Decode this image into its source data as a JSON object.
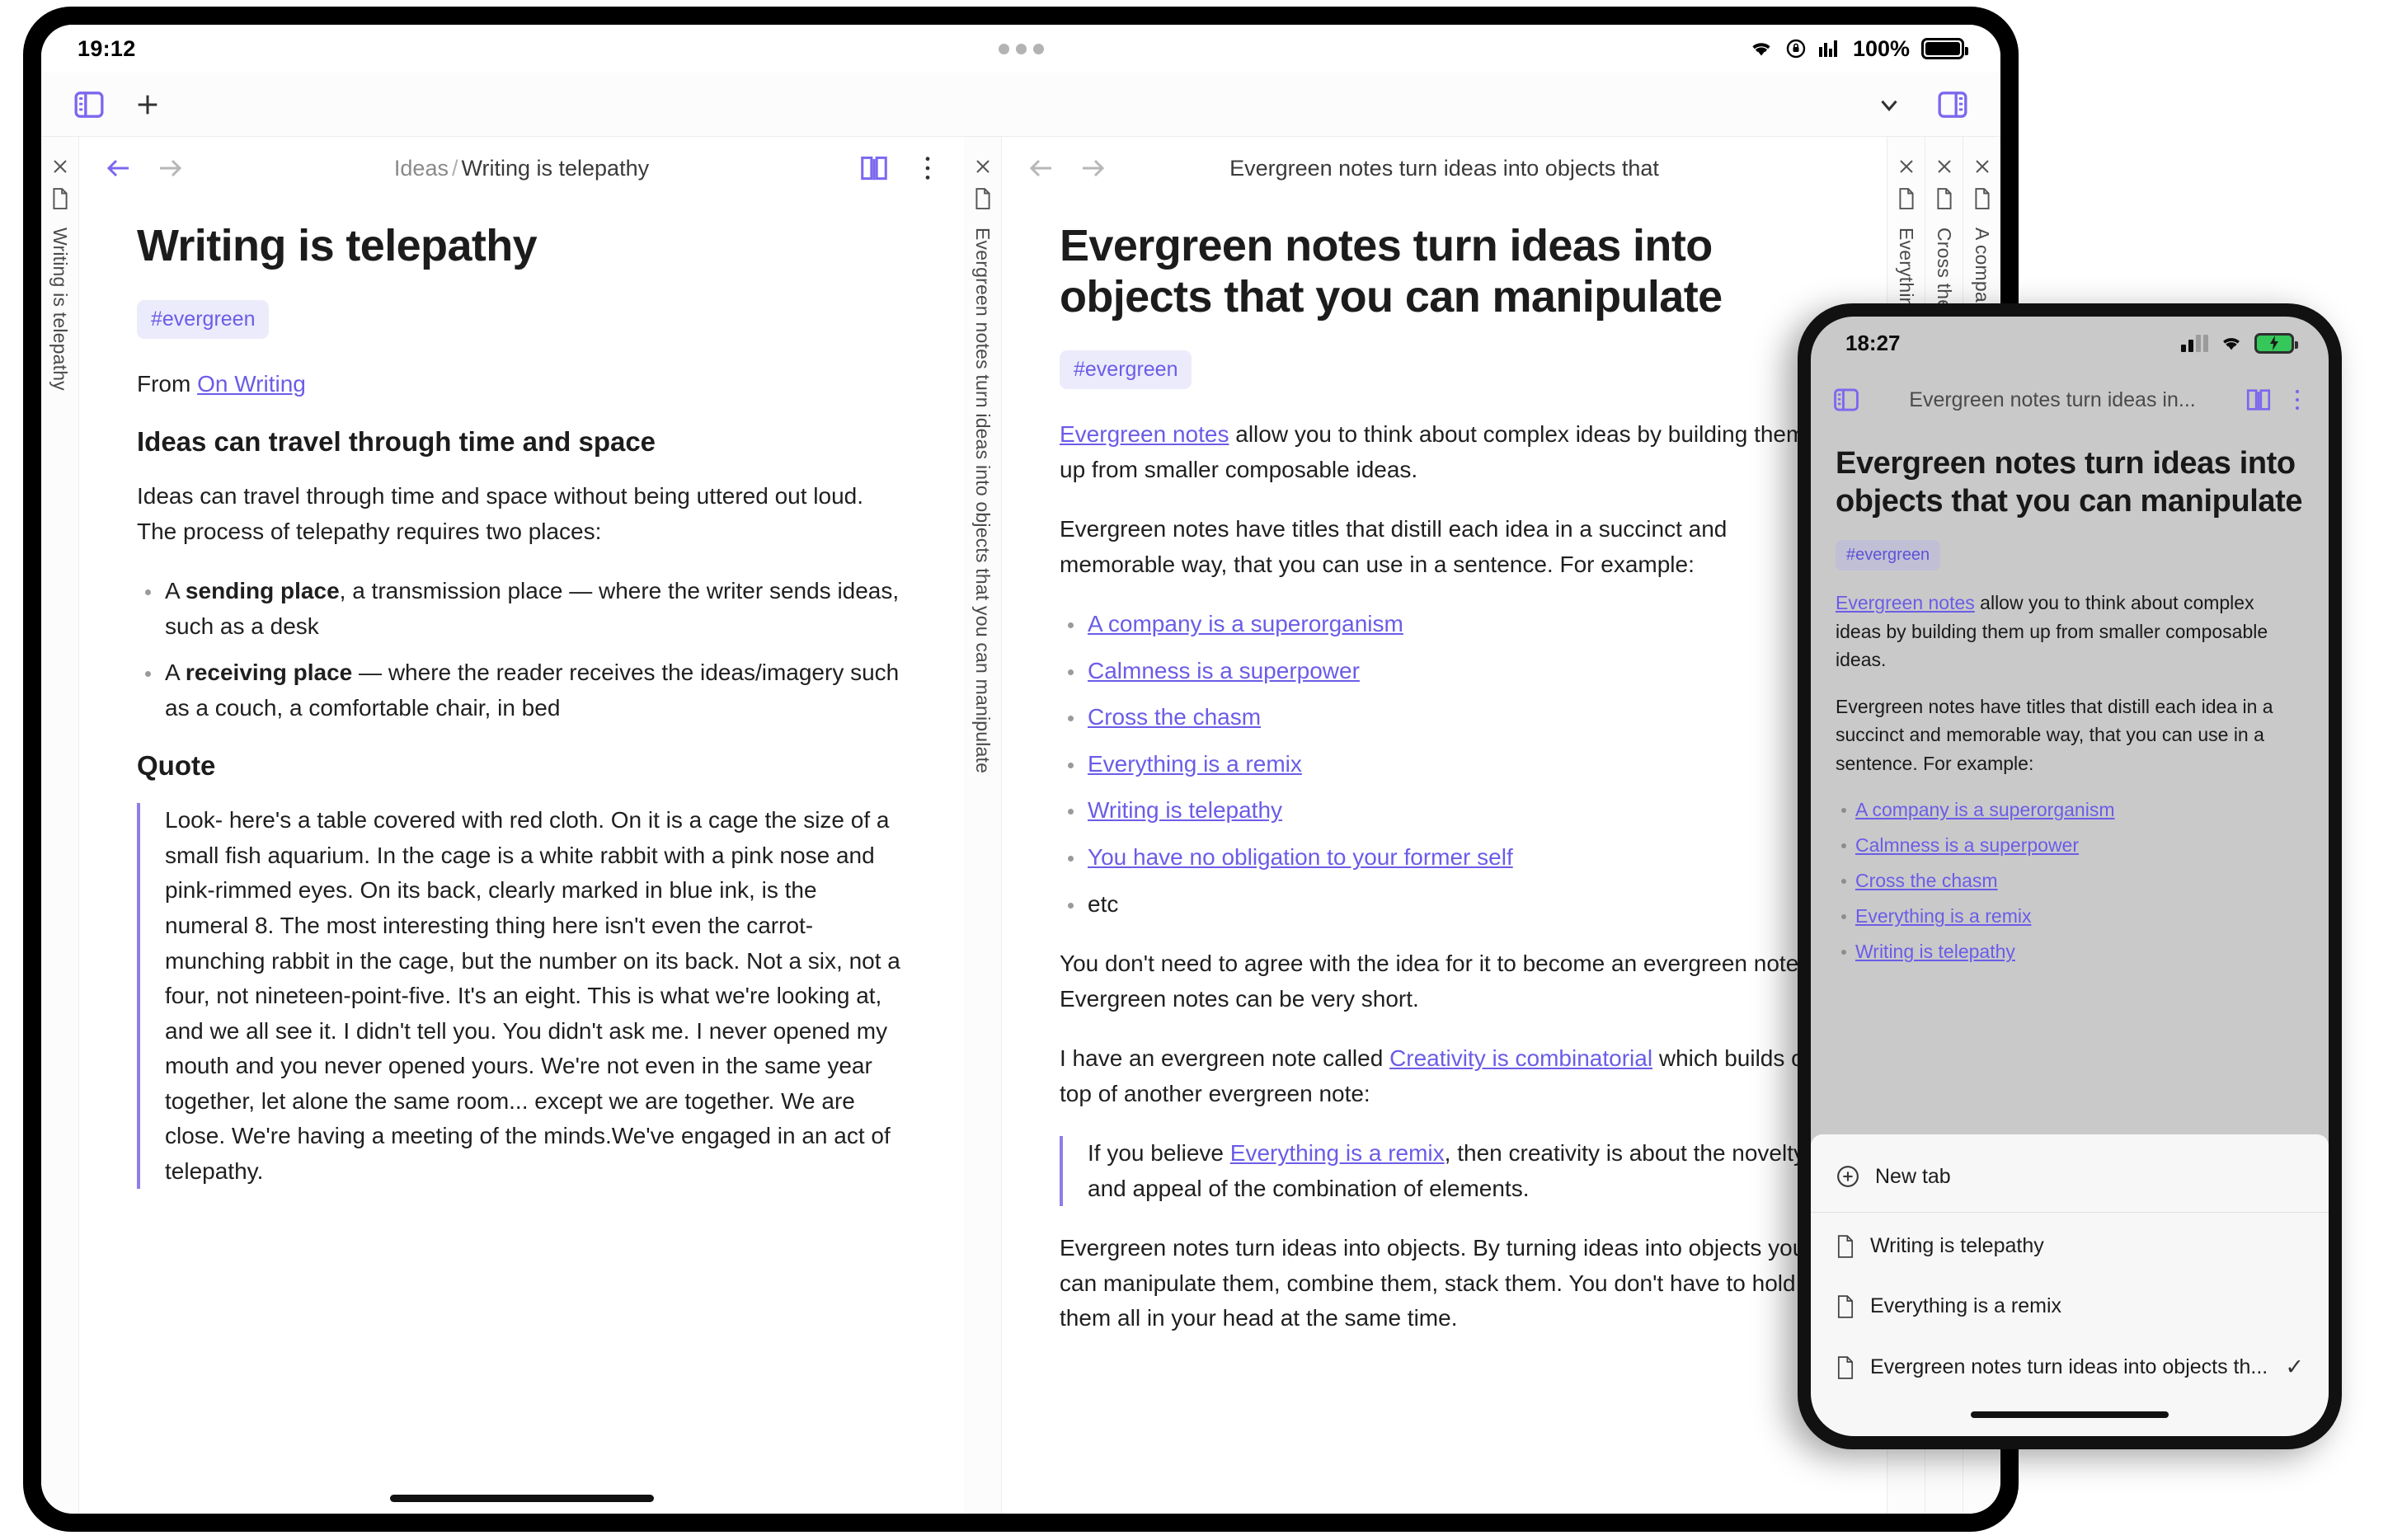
{
  "tablet": {
    "status": {
      "time": "19:12",
      "battery_percent": "100%",
      "icons": [
        "wifi-icon",
        "rotation-lock-icon",
        "signal-bars-icon",
        "battery-icon"
      ]
    },
    "toolbar": {
      "sidebar_toggle": "sidebar-toggle-icon",
      "new_tab": "plus-icon",
      "chevron": "chevron-down-icon",
      "right_sidebar_toggle": "right-sidebar-icon"
    },
    "left_vtab": {
      "label": "Writing is telepathy",
      "close": "close-icon",
      "file": "file-icon"
    },
    "pane1": {
      "breadcrumb_parent": "Ideas",
      "breadcrumb_sep": "/",
      "breadcrumb_current": "Writing is telepathy",
      "back": "arrow-left-icon",
      "forward": "arrow-right-icon",
      "reading_mode": "book-icon",
      "more": "more-vertical-icon",
      "title": "Writing is telepathy",
      "tag": "#evergreen",
      "from_label": "From ",
      "from_link": "On Writing",
      "heading1": "Ideas can travel through time and space",
      "para1": "Ideas can travel through time and space without being uttered out loud. The process of telepathy requires two places:",
      "bullet1_a": "A ",
      "bullet1_b": "sending place",
      "bullet1_c": ", a transmission place — where the writer sends ideas, such as a desk",
      "bullet2_a": "A ",
      "bullet2_b": "receiving place",
      "bullet2_c": " — where the reader receives the ideas/imagery such as a couch, a comfortable chair, in bed",
      "heading2": "Quote",
      "quote": "Look- here's a table covered with red cloth. On it is a cage the size of a small fish aquarium. In the cage is a white rabbit with a pink nose and pink-rimmed eyes. On its back, clearly marked in blue ink, is the numeral 8. The most interesting thing here isn't even the carrot-munching rabbit in the cage, but the number on its back. Not a six, not a four, not nineteen-point-five. It's an eight. This is what we're looking at, and we all see it. I didn't tell you. You didn't ask me. I never opened my mouth and you never opened yours. We're not even in the same year together, let alone the same room... except we are together. We are close. We're having a meeting of the minds.We've engaged in an act of telepathy."
    },
    "pane2_vtab": {
      "label": "Evergreen notes turn ideas into objects that you can manipulate",
      "close": "close-icon",
      "file": "file-icon"
    },
    "pane2": {
      "breadcrumb_current": "Evergreen notes turn ideas into objects that",
      "back": "arrow-left-icon",
      "forward": "arrow-right-icon",
      "title": "Evergreen notes turn ideas into objects that you can manipulate",
      "tag": "#evergreen",
      "para1_link": "Evergreen notes",
      "para1_rest": " allow you to think about complex ideas by building them up from smaller composable ideas.",
      "para2": "Evergreen notes have titles that distill each idea in a succinct and memorable way, that you can use in a sentence. For example:",
      "links": [
        "A company is a superorganism",
        "Calmness is a superpower",
        "Cross the chasm",
        "Everything is a remix",
        "Writing is telepathy",
        "You have no obligation to your former self"
      ],
      "etc": "etc",
      "para3": "You don't need to agree with the idea for it to become an evergreen note. Evergreen notes can be very short.",
      "para4_pre": "I have an evergreen note called ",
      "para4_link": "Creativity is combinatorial",
      "para4_post": " which builds on top of another evergreen note:",
      "quote_pre": "If you believe ",
      "quote_link": "Everything is a remix",
      "quote_post": ", then creativity is about the novelty and appeal of the combination of elements.",
      "para5": "Evergreen notes turn ideas into objects. By turning ideas into objects you can manipulate them, combine them, stack them. You don't have to hold them all in your head at the same time."
    },
    "right_tabs": [
      {
        "label": "Everything is a remix",
        "close": "close-icon",
        "file": "file-icon"
      },
      {
        "label": "Cross the chasm",
        "close": "close-icon",
        "file": "file-icon"
      },
      {
        "label": "A company is a superorganism",
        "close": "close-icon",
        "file": "file-icon"
      }
    ]
  },
  "phone": {
    "status": {
      "time": "18:27",
      "icons": [
        "signal-bars-icon",
        "wifi-icon",
        "battery-charging-icon"
      ]
    },
    "toolbar": {
      "sidebar_toggle": "sidebar-toggle-icon",
      "title": "Evergreen notes turn ideas in...",
      "reading_mode": "book-icon",
      "more": "more-vertical-icon"
    },
    "note": {
      "title": "Evergreen notes turn ideas into objects that you can manipulate",
      "tag": "#evergreen",
      "para1_link": "Evergreen notes",
      "para1_rest": " allow you to think about complex ideas by building them up from smaller composable ideas.",
      "para2": "Evergreen notes have titles that distill each idea in a succinct and memorable way, that you can use in a sentence. For example:",
      "links": [
        "A company is a superorganism",
        "Calmness is a superpower",
        "Cross the chasm",
        "Everything is a remix",
        "Writing is telepathy"
      ]
    },
    "menu": {
      "new_tab": "New tab",
      "new_tab_icon": "plus-circle-icon",
      "items": [
        {
          "label": "Writing is telepathy",
          "checked": ""
        },
        {
          "label": "Everything is a remix",
          "checked": ""
        },
        {
          "label": "Evergreen notes turn ideas into objects th...",
          "checked": "✓"
        }
      ]
    }
  },
  "colors": {
    "accent": "#6b5ce7",
    "tag_bg": "#ecebfb",
    "battery_green": "#35c759"
  }
}
